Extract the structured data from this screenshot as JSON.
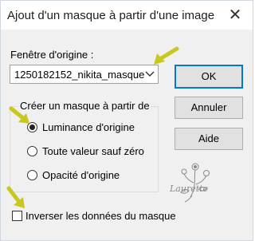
{
  "dialog": {
    "title": "Ajout d'un masque à partir d'une image",
    "close_glyph": "✕"
  },
  "source": {
    "label": "Fenêtre d'origine :",
    "selected": "1250182152_nikita_masque"
  },
  "buttons": {
    "ok": "OK",
    "cancel": "Annuler",
    "help": "Aide"
  },
  "group": {
    "label": "Créer un masque à partir de",
    "options": [
      {
        "label": "Luminance d'origine",
        "checked": true
      },
      {
        "label": "Toute valeur sauf zéro",
        "checked": false
      },
      {
        "label": "Opacité d'origine",
        "checked": false
      }
    ]
  },
  "invert": {
    "label": "Inverser les données du masque",
    "checked": false
  },
  "watermark": {
    "text": "Laurette"
  },
  "colors": {
    "accent": "#0078d7",
    "arrow": "#c8c81e"
  },
  "icons": {
    "close": "close-icon",
    "dropdown": "chevron-down-icon",
    "pointer": "arrow-pointer-icon"
  }
}
